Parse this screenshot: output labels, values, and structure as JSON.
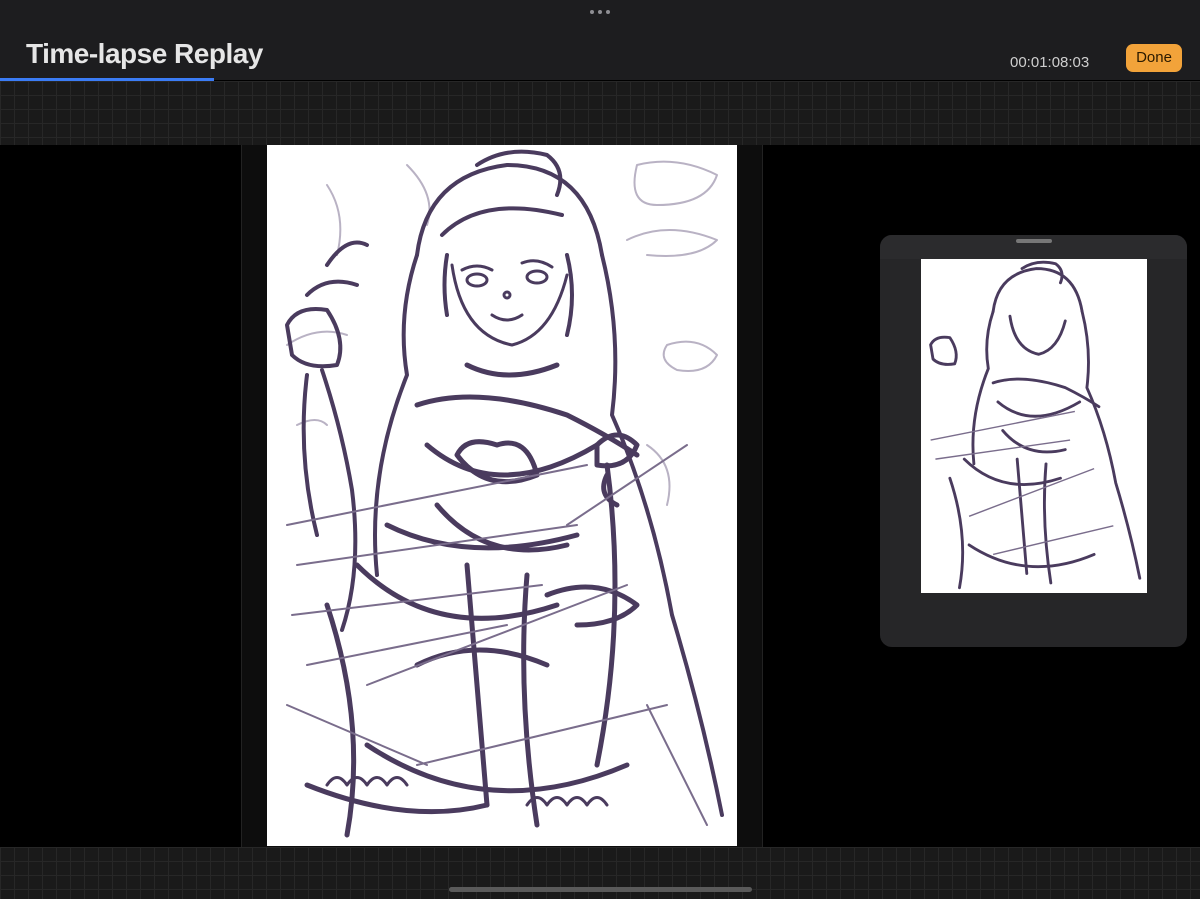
{
  "header": {
    "title": "Time-lapse Replay",
    "timecode": "00:01:08:03",
    "done_label": "Done",
    "more_icon": "ellipsis-icon"
  },
  "playback": {
    "progress_percent": 17.8
  },
  "colors": {
    "accent_blue": "#3b7cf5",
    "done_orange": "#f2a33a",
    "sketch_ink": "#4a3b5e"
  }
}
